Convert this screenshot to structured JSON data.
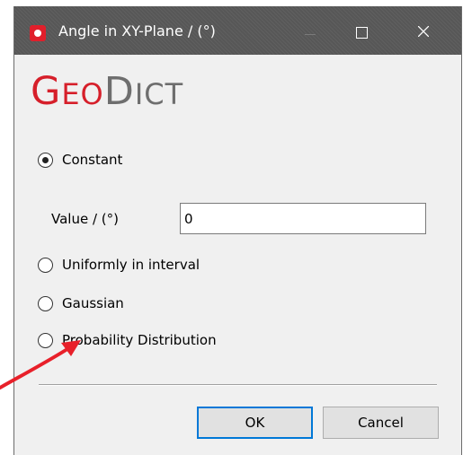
{
  "window": {
    "title": "Angle in XY-Plane / (°)",
    "icon": "geodict-app-icon",
    "controls": [
      "minimize-icon",
      "maximize-icon",
      "close-icon"
    ]
  },
  "brand": {
    "part1_big": "G",
    "part1_small": "EO",
    "part2_big": "D",
    "part2_small": "ICT",
    "color_primary": "#d61f2a",
    "color_secondary": "#6e6e6e"
  },
  "options": {
    "constant": {
      "label": "Constant",
      "checked": true
    },
    "uniform": {
      "label": "Uniformly in interval",
      "checked": false
    },
    "gaussian": {
      "label": "Gaussian",
      "checked": false
    },
    "probability": {
      "label": "Probability Distribution",
      "checked": false
    }
  },
  "value": {
    "label": "Value / (°)",
    "input": "0"
  },
  "buttons": {
    "ok": "OK",
    "cancel": "Cancel"
  },
  "annotation": {
    "arrow_color": "#e8202a",
    "target": "Probability Distribution"
  }
}
